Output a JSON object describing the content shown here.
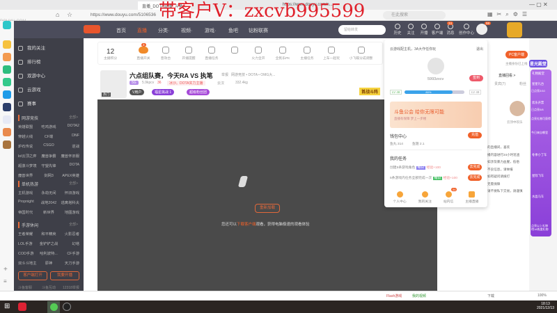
{
  "browser": {
    "tabs": [
      "直播_DOTA直播_斗鱼...",
      "https://www.douyu.com/n..."
    ],
    "url": "https://www.douyu.com/5106536",
    "search_placeholder": "在此搜索",
    "watermark_logo": "DOUYU.COM"
  },
  "watermark": "带客户V：zxcvb995599",
  "nav": {
    "items": [
      "首页",
      "直播",
      "分类·",
      "视频·",
      "游戏·",
      "鱼吧",
      "钻粉联赛"
    ],
    "search_placeholder": "留给转发",
    "tools": [
      "历史",
      "关注",
      "开播",
      "客户端",
      "消息",
      "创作中心"
    ],
    "badges": {
      "client": "1",
      "messages": "24",
      "avatar": "58"
    }
  },
  "sidebar": {
    "items": [
      "我的关注",
      "排行榜",
      "双游中心",
      "云游戏",
      "赛事"
    ],
    "sections": [
      {
        "title": "网游竞技",
        "more": "全部>",
        "games": [
          "英雄联盟",
          "吃鸡游戏",
          "DOTA2",
          "穿越火线",
          "CF端",
          "DNF",
          "炉石传说",
          "CSGO",
          "逆战",
          "lol云顶之弈",
          "魔兽争霸",
          "魔兽怀旧服",
          "超激斗梦境",
          "守望先锋",
          "DOTA",
          "魔兽世界",
          "剑网3",
          "APEX英雄"
        ]
      },
      {
        "title": "单机热游",
        "more": "全部>",
        "games": [
          "主机游戏",
          "永劫无间",
          "怀旧游戏",
          "Propnight",
          "战地2042",
          "逃离塔科夫",
          "帝国时代",
          "新世界",
          "地图游戏"
        ]
      },
      {
        "title": "手游休闲",
        "more": "全部>",
        "games": [
          "王者荣耀",
          "和平精英",
          "火影忍者",
          "LOL手游",
          "金铲铲之战",
          "幻塔",
          "COD手游",
          "哈利波特...",
          "CF手游",
          "双斗斗地主",
          "原神",
          "天刀手游"
        ]
      }
    ],
    "buttons": [
      "客户端打开",
      "我要开播"
    ],
    "footer": [
      "斗鱼客服",
      "斗鱼互动",
      "12318举报"
    ]
  },
  "toolbar": {
    "points_value": "12",
    "points_label": "主播积分",
    "items": [
      "直播开关",
      "音效台",
      "开播提醒",
      "直播任务",
      "",
      "火力全开",
      "全民乐PK",
      "主播任务",
      "上车一起玩",
      "小飞碟分成调整"
    ],
    "switch_badge": "3"
  },
  "room": {
    "title": "六点组队赛，今天RA VS 执笔",
    "tag": "举报",
    "category": "网游竞技 • DOTA • OMG大...",
    "level": "5G",
    "heat": "5.9kpcv",
    "fans": "36",
    "hot_tag": "冰沙。DOTA实力主播",
    "location": "云汉",
    "weight": "332.4kg",
    "badges": [
      "V用户",
      "福星挑战 1",
      "超级粉丝团"
    ],
    "cover_label": "热门",
    "promo": "首战斗阵"
  },
  "player": {
    "retry": "重新加载",
    "message_pre": "您还可以",
    "message_link": "下载客户端",
    "message_post": "观看，获得电脑极速的观看体验"
  },
  "popup": {
    "header": "云游戏配主机，3A大作任你玩",
    "exit": "退出",
    "username": "5993zxcv",
    "sign_btn": "签到",
    "level_left": "LV 48",
    "level_right": "LV 49",
    "progress_label": "80%",
    "progress": 0.8,
    "banner_title": "斗鱼公会 给你无限可能",
    "banner_sub": "直播有保障  梦上一步楼",
    "wallet_title": "钱包中心",
    "wallet_btn": "充值",
    "fish_balls": "鱼丸 314",
    "fish_fins": "鱼翅 2.1",
    "tasks_title": "我的任务",
    "tasks": [
      {
        "text": "创建5条游戏角色",
        "tag": "每日",
        "reward": "经验+100",
        "btn": "去完成"
      },
      {
        "text": "5条游戏内任务全部完成一次",
        "tag": "每日",
        "reward": "经验+100",
        "btn": "去完成"
      }
    ],
    "shortcuts": [
      "个人中心",
      "我的关注",
      "站内信",
      "主播直播"
    ],
    "mail_badge": "54"
  },
  "right": {
    "pc_client": "PC客户端",
    "pc_sub": "主播身份已上线",
    "replay": "直播回看 >",
    "tabs": [
      "贵宾(7)",
      "粉丝"
    ],
    "anchor_name": "云顶中欢乐",
    "desc_lines": [
      "的直播间，喜欢",
      "播内容进行24小时巡查",
      "如涉及暴力血腥，低俗",
      "不良信息，请举报",
      "如有疑问请拨打",
      "无需保障",
      "请不要私下交易，请谨慎"
    ]
  },
  "promo": {
    "title": "星光殿堂",
    "section1": "礼物殿堂",
    "items1": [
      "星星礼台",
      "欢乐开票"
    ],
    "counts": [
      "已点亮2/10",
      "已点亮0/8"
    ],
    "cta": "点亮礼物可获得",
    "section2": "今日来自哪里",
    "items2": [
      "冬季小丁车",
      "星际飞车",
      "水晶马车"
    ],
    "footer": "点亮以上礼物 得18热度礼物"
  },
  "status": {
    "items": [
      "Flash游戏",
      "我的视频",
      "下载"
    ],
    "zoom": "100%"
  },
  "taskbar": {
    "time": "18:13",
    "date": "2021/12/13"
  }
}
